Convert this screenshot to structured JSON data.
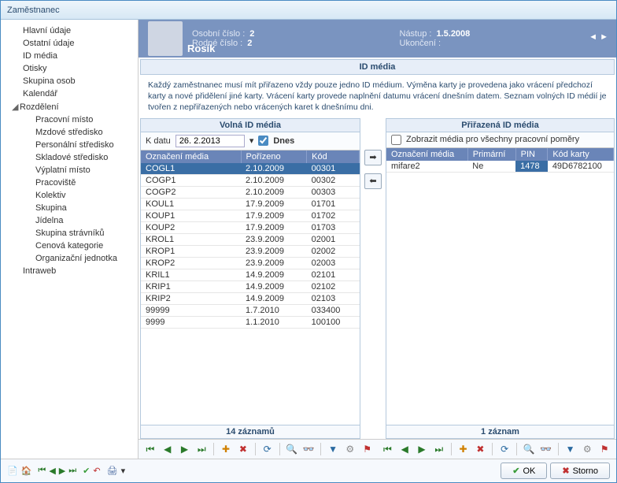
{
  "window": {
    "title": "Zaměstnanec"
  },
  "sidebar": {
    "items": [
      {
        "label": "Hlavní údaje",
        "level": 1
      },
      {
        "label": "Ostatní údaje",
        "level": 1
      },
      {
        "label": "ID média",
        "level": 1
      },
      {
        "label": "Otisky",
        "level": 1
      },
      {
        "label": "Skupina osob",
        "level": 1
      },
      {
        "label": "Kalendář",
        "level": 1
      },
      {
        "label": "Rozdělení",
        "level": 1,
        "expanded": true
      },
      {
        "label": "Pracovní místo",
        "level": 2
      },
      {
        "label": "Mzdové středisko",
        "level": 2
      },
      {
        "label": "Personální středisko",
        "level": 2
      },
      {
        "label": "Skladové středisko",
        "level": 2
      },
      {
        "label": "Výplatní místo",
        "level": 2
      },
      {
        "label": "Pracoviště",
        "level": 2
      },
      {
        "label": "Kolektiv",
        "level": 2
      },
      {
        "label": "Skupina",
        "level": 2
      },
      {
        "label": "Jídelna",
        "level": 2
      },
      {
        "label": "Skupina strávníků",
        "level": 2
      },
      {
        "label": "Cenová kategorie",
        "level": 2
      },
      {
        "label": "Organizační jednotka",
        "level": 2
      },
      {
        "label": "Intraweb",
        "level": 1
      }
    ]
  },
  "header": {
    "name": "Rosík",
    "fields": {
      "osobni_label": "Osobní číslo :",
      "osobni_val": "2",
      "rodne_label": "Rodné číslo :",
      "rodne_val": "2",
      "nastup_label": "Nástup :",
      "nastup_val": "1.5.2008",
      "ukonceni_label": "Ukončení :",
      "ukonceni_val": ""
    }
  },
  "section": {
    "title": "ID média",
    "notice": "Každý zaměstnanec musí mít přiřazeno vždy pouze jedno ID médium. Výměna karty je provedena jako vrácení předchozí karty a nové přidělení jiné karty. Vrácení karty provede naplnění datumu vrácení dnešním datem. Seznam volných ID médií je tvořen z nepřiřazených nebo vrácených karet k dnešnímu dni."
  },
  "panels": {
    "left": {
      "title": "Volná ID média",
      "date_label": "K datu",
      "date_val": "26. 2.2013",
      "today_label": "Dnes",
      "today_checked": true,
      "columns": [
        "Označení média",
        "Pořízeno",
        "Kód"
      ],
      "rows": [
        {
          "c0": "COGL1",
          "c1": "2.10.2009",
          "c2": "00301",
          "sel": true
        },
        {
          "c0": "COGP1",
          "c1": "2.10.2009",
          "c2": "00302"
        },
        {
          "c0": "COGP2",
          "c1": "2.10.2009",
          "c2": "00303"
        },
        {
          "c0": "KOUL1",
          "c1": "17.9.2009",
          "c2": "01701"
        },
        {
          "c0": "KOUP1",
          "c1": "17.9.2009",
          "c2": "01702"
        },
        {
          "c0": "KOUP2",
          "c1": "17.9.2009",
          "c2": "01703"
        },
        {
          "c0": "KROL1",
          "c1": "23.9.2009",
          "c2": "02001"
        },
        {
          "c0": "KROP1",
          "c1": "23.9.2009",
          "c2": "02002"
        },
        {
          "c0": "KROP2",
          "c1": "23.9.2009",
          "c2": "02003"
        },
        {
          "c0": "KRIL1",
          "c1": "14.9.2009",
          "c2": "02101"
        },
        {
          "c0": "KRIP1",
          "c1": "14.9.2009",
          "c2": "02102"
        },
        {
          "c0": "KRIP2",
          "c1": "14.9.2009",
          "c2": "02103"
        },
        {
          "c0": "99999",
          "c1": "1.7.2010",
          "c2": "033400"
        },
        {
          "c0": "9999",
          "c1": "1.1.2010",
          "c2": "100100"
        }
      ],
      "footer": "14 záznamů"
    },
    "right": {
      "title": "Přiřazená ID média",
      "show_all_label": "Zobrazit média pro všechny pracovní poměry",
      "show_all_checked": false,
      "columns": [
        "Označení média",
        "Primární",
        "PIN",
        "Kód karty"
      ],
      "rows": [
        {
          "c0": "mifare2",
          "c1": "Ne",
          "c2": "1478",
          "c3": "49D6782100",
          "pinsel": true
        }
      ],
      "footer": "1 záznam"
    }
  },
  "buttons": {
    "ok": "OK",
    "cancel": "Storno"
  }
}
